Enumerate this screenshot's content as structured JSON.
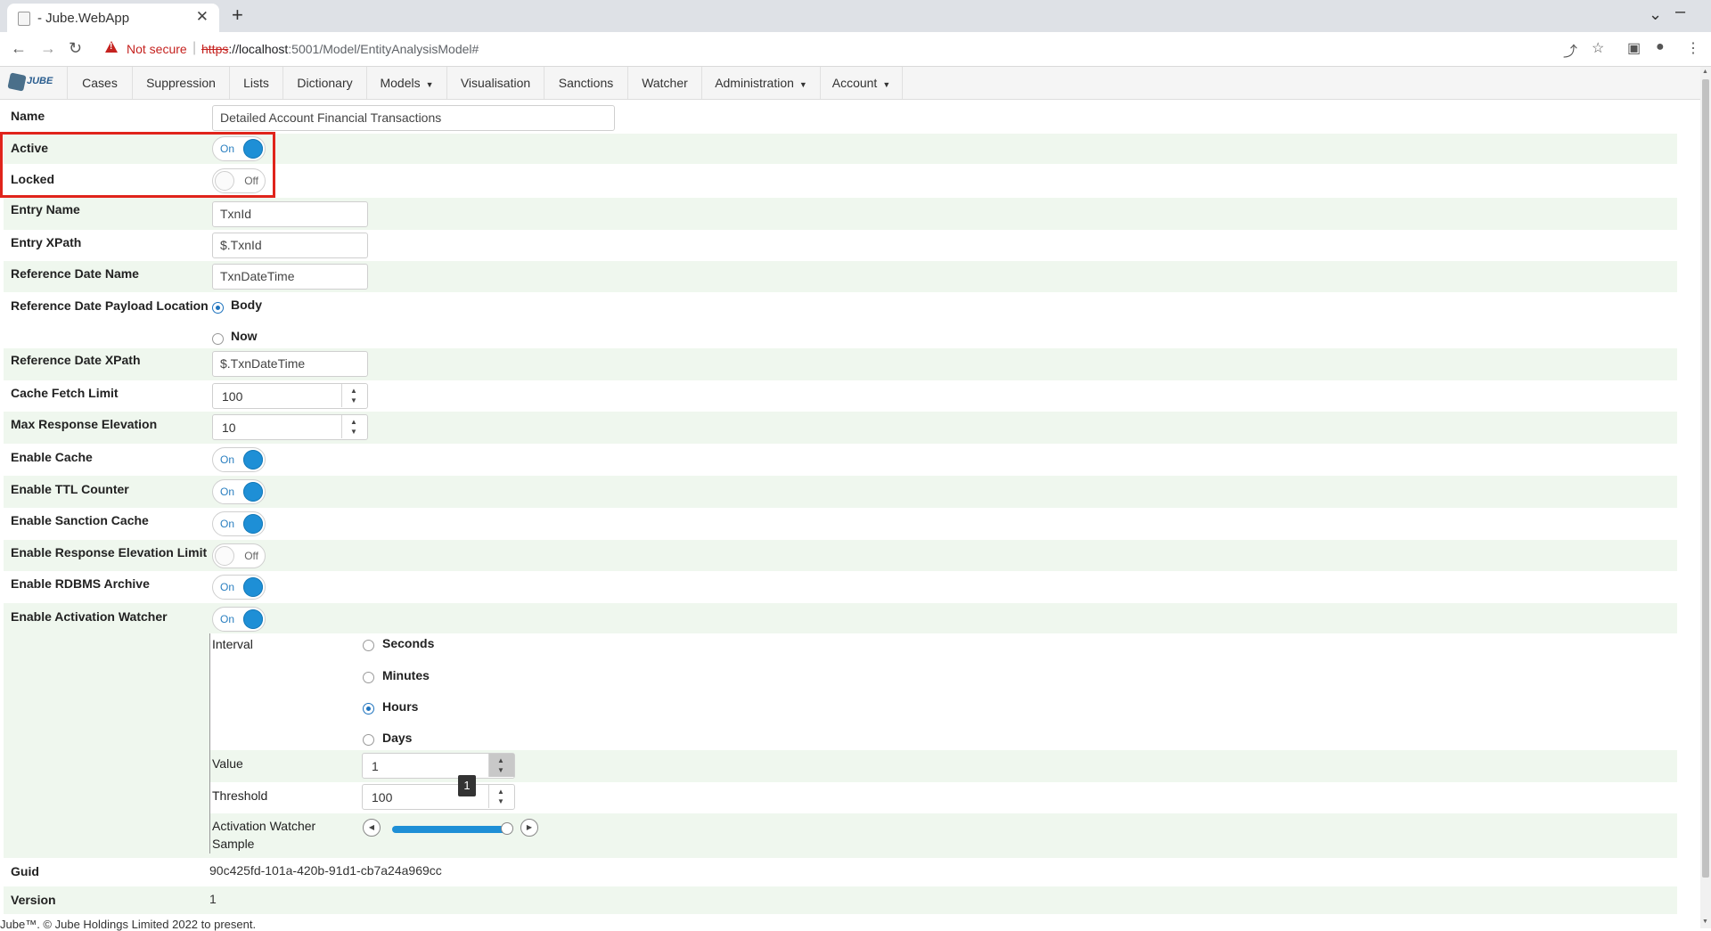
{
  "browser": {
    "tab_title": "- Jube.WebApp",
    "not_secure": "Not secure",
    "url_scheme": "https",
    "url_host": "://localhost",
    "url_rest": ":5001/Model/EntityAnalysisModel#"
  },
  "nav": {
    "items": [
      {
        "label": "Cases"
      },
      {
        "label": "Suppression"
      },
      {
        "label": "Lists"
      },
      {
        "label": "Dictionary"
      },
      {
        "label": "Models"
      },
      {
        "label": "Visualisation"
      },
      {
        "label": "Sanctions"
      },
      {
        "label": "Watcher"
      },
      {
        "label": "Administration"
      },
      {
        "label": "Account"
      }
    ],
    "logo_text": "JUBE"
  },
  "form": {
    "name_label": "Name",
    "name_value": "Detailed Account Financial Transactions",
    "active_label": "Active",
    "active_state": "On",
    "locked_label": "Locked",
    "locked_state": "Off",
    "entry_name_label": "Entry Name",
    "entry_name_value": "TxnId",
    "entry_xpath_label": "Entry XPath",
    "entry_xpath_value": "$.TxnId",
    "ref_date_name_label": "Reference Date Name",
    "ref_date_name_value": "TxnDateTime",
    "ref_date_loc_label": "Reference Date Payload Location",
    "ref_date_loc_options": [
      "Body",
      "Now"
    ],
    "ref_date_loc_selected": "Body",
    "ref_date_xpath_label": "Reference Date XPath",
    "ref_date_xpath_value": "$.TxnDateTime",
    "cache_fetch_limit_label": "Cache Fetch Limit",
    "cache_fetch_limit_value": "100",
    "max_resp_elev_label": "Max Response Elevation",
    "max_resp_elev_value": "10",
    "enable_cache_label": "Enable Cache",
    "enable_cache_state": "On",
    "enable_ttl_label": "Enable TTL Counter",
    "enable_ttl_state": "On",
    "enable_sanction_label": "Enable Sanction Cache",
    "enable_sanction_state": "On",
    "enable_resp_elev_limit_label": "Enable Response Elevation Limit",
    "enable_resp_elev_limit_state": "Off",
    "enable_rdbms_label": "Enable RDBMS Archive",
    "enable_rdbms_state": "On",
    "enable_watcher_label": "Enable Activation Watcher",
    "enable_watcher_state": "On",
    "interval_label": "Interval",
    "interval_options": [
      "Seconds",
      "Minutes",
      "Hours",
      "Days"
    ],
    "interval_selected": "Hours",
    "value_label": "Value",
    "value_value": "1",
    "threshold_label": "Threshold",
    "threshold_value": "100",
    "sample_label_1": "Activation Watcher",
    "sample_label_2": "Sample",
    "sample_fraction": 1.0,
    "tooltip_value": "1",
    "guid_label": "Guid",
    "guid_value": "90c425fd-101a-420b-91d1-cb7a24a969cc",
    "version_label": "Version",
    "version_value": "1"
  },
  "footer": "Jube™. © Jube Holdings Limited 2022 to present."
}
